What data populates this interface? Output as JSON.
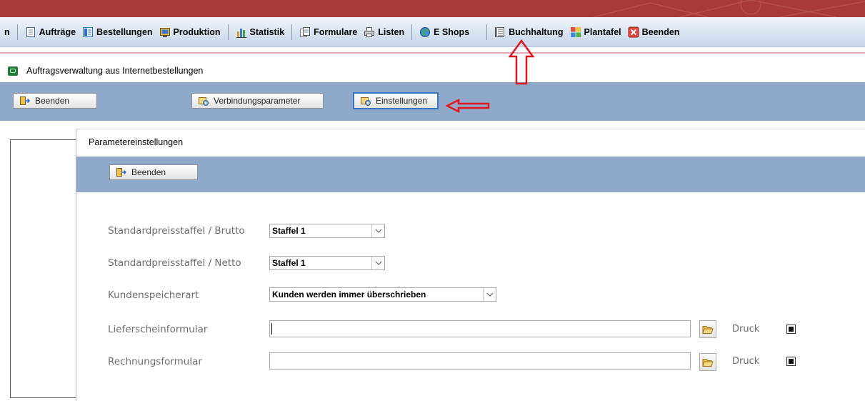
{
  "toolbar": {
    "items": [
      {
        "label": "n"
      },
      {
        "label": "Aufträge"
      },
      {
        "label": "Bestellungen"
      },
      {
        "label": "Produktion"
      },
      {
        "label": "Statistik"
      },
      {
        "label": "Formulare"
      },
      {
        "label": "Listen"
      },
      {
        "label": "E Shops"
      },
      {
        "label": "Buchhaltung"
      },
      {
        "label": "Plantafel"
      },
      {
        "label": "Beenden"
      }
    ]
  },
  "window": {
    "title": "Auftragsverwaltung aus Internetbestellungen",
    "buttons": {
      "exit": "Beenden",
      "connection": "Verbindungsparameter",
      "settings": "Einstellungen"
    }
  },
  "dialog": {
    "title": "Parametereinstellungen",
    "exit_button": "Beenden",
    "fields": {
      "price_gross": {
        "label": "Standardpreisstaffel / Brutto",
        "value": "Staffel 1"
      },
      "price_net": {
        "label": "Standardpreisstaffel / Netto",
        "value": "Staffel 1"
      },
      "customer_storage": {
        "label": "Kundenspeicherart",
        "value": "Kunden werden immer überschrieben"
      },
      "delivery_form": {
        "label": "Lieferscheinformular",
        "value": "",
        "print_label": "Druck",
        "print_checked": true
      },
      "invoice_form": {
        "label": "Rechnungsformular",
        "value": "",
        "print_label": "Druck",
        "print_checked": true
      }
    }
  },
  "colors": {
    "banner": "#a83a3c",
    "ribbon": "#8ea9c9",
    "annotation": "#e0161c"
  }
}
